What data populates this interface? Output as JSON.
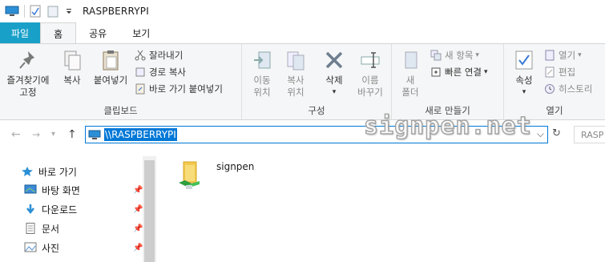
{
  "window": {
    "title": "RASPBERRYPI"
  },
  "tabs": [
    {
      "label": "파일"
    },
    {
      "label": "홈"
    },
    {
      "label": "공유"
    },
    {
      "label": "보기"
    }
  ],
  "ribbon": {
    "clipboard": {
      "label": "클립보드",
      "pin_line1": "즐겨찾기에",
      "pin_line2": "고정",
      "copy": "복사",
      "paste": "붙여넣기",
      "cut": "잘라내기",
      "copy_path": "경로 복사",
      "paste_shortcut": "바로 가기 붙여넣기"
    },
    "organize": {
      "label": "구성",
      "move_line1": "이동",
      "move_line2": "위치",
      "copyto_line1": "복사",
      "copyto_line2": "위치",
      "delete": "삭제",
      "rename_line1": "이름",
      "rename_line2": "바꾸기"
    },
    "new": {
      "label": "새로 만들기",
      "folder_line1": "새",
      "folder_line2": "폴더",
      "new_item": "새 항목",
      "easy_access": "빠른 연결"
    },
    "open": {
      "label": "열기",
      "properties": "속성",
      "open": "열기",
      "edit": "편집",
      "history": "히스토리"
    }
  },
  "address": {
    "path": "\\\\RASPBERRYPI",
    "search_placeholder": "RASP"
  },
  "sidebar": {
    "items": [
      {
        "label": "바로 가기"
      },
      {
        "label": "바탕 화면"
      },
      {
        "label": "다운로드"
      },
      {
        "label": "문서"
      },
      {
        "label": "사진"
      }
    ]
  },
  "content": {
    "items": [
      {
        "name": "signpen"
      }
    ]
  },
  "watermark": "signpen.net",
  "colors": {
    "accent": "#0078d7",
    "file_tab": "#19a0c9"
  }
}
